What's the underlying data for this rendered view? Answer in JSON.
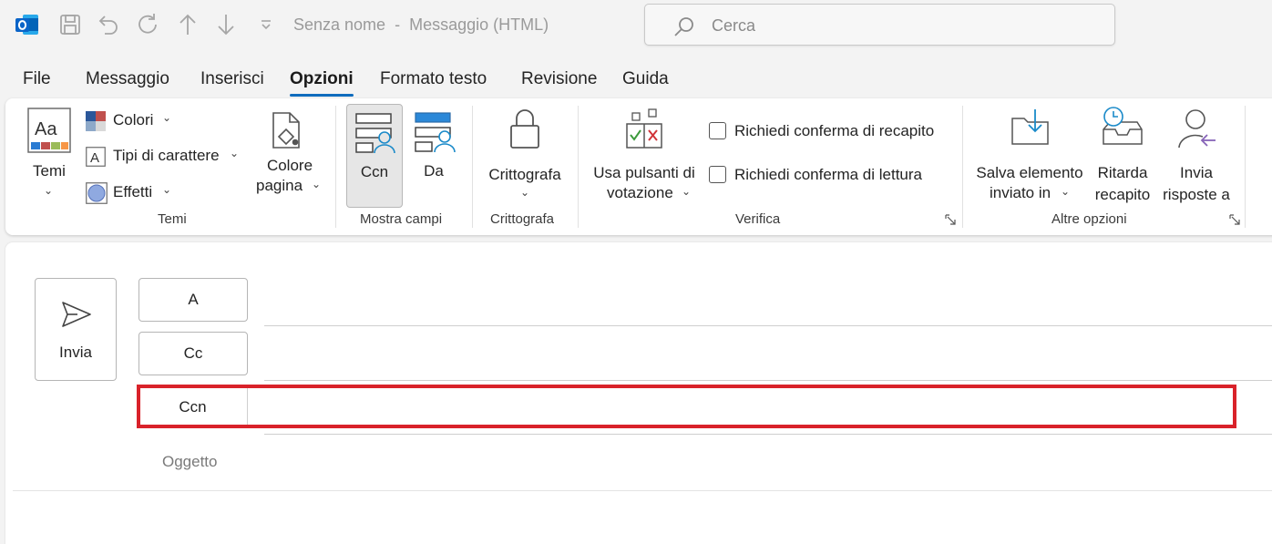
{
  "titlebar": {
    "title": "Senza nome",
    "separator": "-",
    "subtitle": "Messaggio (HTML)",
    "search_placeholder": "Cerca",
    "icons": [
      "outlook-logo-icon",
      "save-icon",
      "undo-icon",
      "redo-icon",
      "up-arrow-icon",
      "down-arrow-icon",
      "customize-dropdown-icon",
      "search-icon"
    ]
  },
  "tabs": [
    {
      "label": "File"
    },
    {
      "label": "Messaggio"
    },
    {
      "label": "Inserisci"
    },
    {
      "label": "Opzioni",
      "active": true
    },
    {
      "label": "Formato testo"
    },
    {
      "label": "Revisione"
    },
    {
      "label": "Guida"
    }
  ],
  "ribbon": {
    "temi": {
      "group_label": "Temi",
      "themes_label": "Temi",
      "colors_label": "Colori",
      "fonts_label": "Tipi di carattere",
      "effects_label": "Effetti",
      "page_color_line1": "Colore",
      "page_color_line2": "pagina"
    },
    "mostra_campi": {
      "group_label": "Mostra campi",
      "bcc_label": "Ccn",
      "from_label": "Da"
    },
    "crittografa": {
      "group_label": "Crittografa",
      "encrypt_label": "Crittografa"
    },
    "verifica": {
      "group_label": "Verifica",
      "voting_line1": "Usa pulsanti di",
      "voting_line2": "votazione",
      "delivery_receipt": "Richiedi conferma di recapito",
      "read_receipt": "Richiedi conferma di lettura"
    },
    "altre_opzioni": {
      "group_label": "Altre opzioni",
      "save_sent_line1": "Salva elemento",
      "save_sent_line2": "inviato in",
      "delay_line1": "Ritarda",
      "delay_line2": "recapito",
      "reply_line1": "Invia",
      "reply_line2": "risposte a"
    }
  },
  "compose": {
    "send_label": "Invia",
    "to_label": "A",
    "cc_label": "Cc",
    "bcc_label": "Ccn",
    "subject_label": "Oggetto"
  },
  "colors": {
    "accent": "#0f6cbd",
    "highlight": "#d9222a",
    "outlook_blue": "#0a64c8"
  }
}
